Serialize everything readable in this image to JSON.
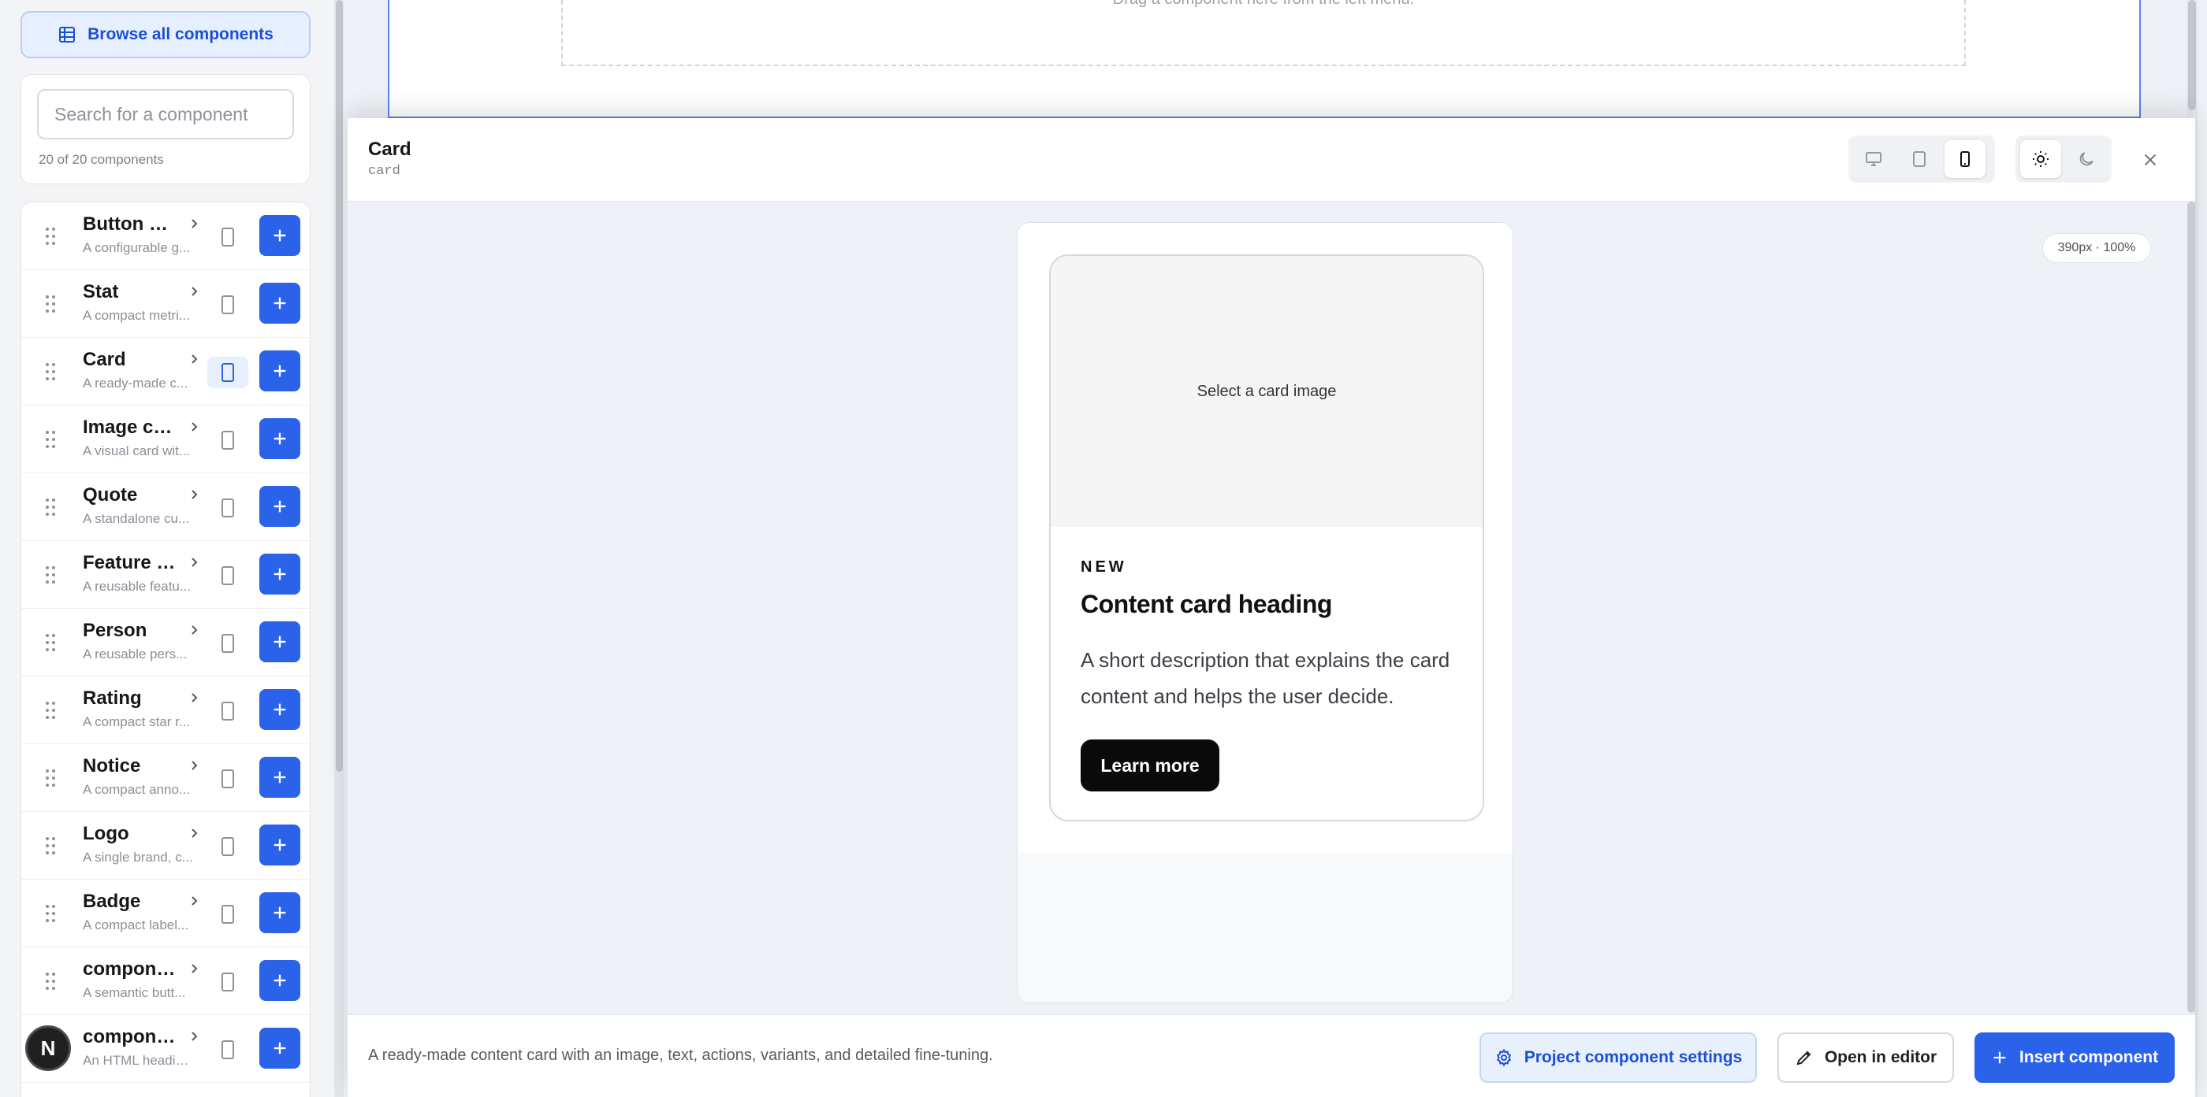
{
  "sidebar": {
    "browse_label": "Browse all components",
    "search_placeholder": "Search for a component",
    "count_text": "20 of 20 components",
    "items": [
      {
        "name": "Button gr...",
        "desc": "A configurable g...",
        "active": false
      },
      {
        "name": "Stat",
        "desc": "A compact metri...",
        "active": false
      },
      {
        "name": "Card",
        "desc": "A ready-made c...",
        "active": true
      },
      {
        "name": "Image card",
        "desc": "A visual card wit...",
        "active": false
      },
      {
        "name": "Quote",
        "desc": "A standalone cu...",
        "active": false
      },
      {
        "name": "Feature it...",
        "desc": "A reusable featu...",
        "active": false
      },
      {
        "name": "Person",
        "desc": "A reusable pers...",
        "active": false
      },
      {
        "name": "Rating",
        "desc": "A compact star r...",
        "active": false
      },
      {
        "name": "Notice",
        "desc": "A compact anno...",
        "active": false
      },
      {
        "name": "Logo",
        "desc": "A single brand, c...",
        "active": false
      },
      {
        "name": "Badge",
        "desc": "A compact label...",
        "active": false
      },
      {
        "name": "component...",
        "desc": "A semantic butt...",
        "active": false
      },
      {
        "name": "component...",
        "desc": "An HTML headin...",
        "active": false
      }
    ],
    "avatar_letter": "N"
  },
  "canvas": {
    "dropzone_text": "Drag a component here from the left menu."
  },
  "modal": {
    "title": "Card",
    "slug": "card",
    "devices": [
      "desktop-icon",
      "tablet-icon",
      "phone-icon"
    ],
    "active_device": "phone-icon",
    "themes": [
      "sun-icon",
      "moon-icon"
    ],
    "active_theme": "sun-icon",
    "size_label": "390px · 100%",
    "card": {
      "image_label": "Select a card image",
      "eyebrow": "NEW",
      "heading": "Content card heading",
      "description": "A short description that explains the card content and helps the user decide.",
      "cta": "Learn more"
    },
    "footer": {
      "description": "A ready-made content card with an image, text, actions, variants, and detailed fine-tuning.",
      "settings_label": "Project component settings",
      "editor_label": "Open in editor",
      "insert_label": "Insert component"
    }
  },
  "colors": {
    "accent": "#2b62ea",
    "accent_soft": "#e6effd",
    "text": "#15171b",
    "muted": "#8b9098"
  }
}
